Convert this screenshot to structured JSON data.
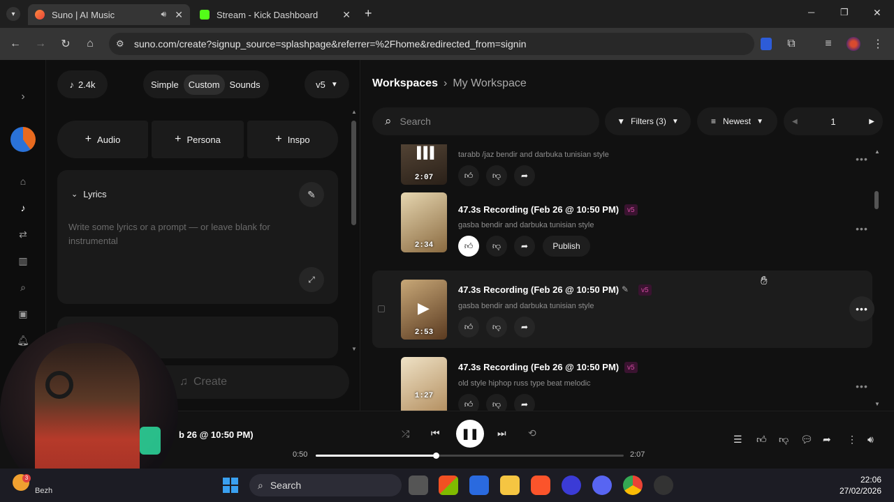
{
  "browser": {
    "tabs": [
      {
        "title": "Suno | AI Music",
        "active": true
      },
      {
        "title": "Stream - Kick Dashboard",
        "active": false
      }
    ],
    "new_tab": "+",
    "url": "suno.com/create?signup_source=splashpage&referrer=%2Fhome&redirected_from=signin",
    "window_controls": {
      "minimize": "─",
      "maximize": "❐",
      "close": "✕"
    }
  },
  "sidebar": {
    "icons": [
      "expand-icon",
      "avatar",
      "home-icon",
      "create-icon",
      "studio-icon",
      "library-icon",
      "search-icon",
      "hooks-icon",
      "notifications-icon"
    ]
  },
  "create_panel": {
    "credits": "2.4k",
    "modes": [
      "Simple",
      "Custom",
      "Sounds"
    ],
    "active_mode": "Custom",
    "model": "v5",
    "add_buttons": [
      "Audio",
      "Persona",
      "Inspo"
    ],
    "lyrics_label": "Lyrics",
    "lyrics_placeholder": "Write some lyrics or a prompt — or leave blank for instrumental",
    "create_label": "Create"
  },
  "workspace": {
    "breadcrumb_root": "Workspaces",
    "breadcrumb_current": "My Workspace",
    "search_placeholder": "Search",
    "filters_label": "Filters (3)",
    "sort_label": "Newest",
    "page": "1",
    "songs": [
      {
        "title": "",
        "desc": "tarabb /jaz bendir and darbuka tunisian style",
        "duration": "2:07",
        "badge": "",
        "playing": true,
        "publish": ""
      },
      {
        "title": "47.3s Recording (Feb 26 @ 10:50 PM)",
        "desc": "gasba bendir and darbuka tunisian style",
        "duration": "2:34",
        "badge": "v5",
        "liked": true,
        "publish": "Publish"
      },
      {
        "title": "47.3s Recording (Feb 26 @ 10:50 PM)",
        "desc": "gasba bendir and darbuka tunisian style",
        "duration": "2:53",
        "badge": "v5",
        "hover": true,
        "publish": ""
      },
      {
        "title": "47.3s Recording (Feb 26 @ 10:50 PM)",
        "desc": "old style hiphop russ type beat melodic",
        "duration": "1:27",
        "badge": "v5",
        "publish": ""
      }
    ]
  },
  "player": {
    "track_title": "b 26 @ 10:50 PM)",
    "elapsed": "0:50",
    "total": "2:07",
    "progress": 0.39
  },
  "taskbar": {
    "search_label": "Search",
    "time": "22:06",
    "date": "27/02/2026",
    "weather_label": "Bezh",
    "weather_badge": "3"
  }
}
